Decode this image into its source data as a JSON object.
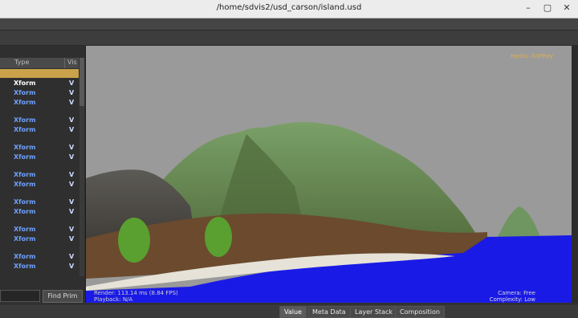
{
  "window": {
    "title": "/home/sdvis2/usd_carson/island.usd",
    "controls": [
      "–",
      "▢",
      "✕"
    ]
  },
  "prim_tree": {
    "col_type": "Type",
    "col_vis": "Vis",
    "rows": [
      {
        "type": "Xform",
        "vis": "V",
        "style": "white"
      },
      {
        "type": "Xform",
        "vis": "V",
        "style": "blue"
      },
      {
        "type": "Xform",
        "vis": "V",
        "style": "blue"
      },
      {
        "type": "Xform",
        "vis": "V",
        "style": "blue"
      },
      {
        "type": "Xform",
        "vis": "V",
        "style": "blue"
      },
      {
        "type": "Xform",
        "vis": "V",
        "style": "blue"
      },
      {
        "type": "Xform",
        "vis": "V",
        "style": "blue"
      },
      {
        "type": "Xform",
        "vis": "V",
        "style": "blue"
      },
      {
        "type": "Xform",
        "vis": "V",
        "style": "blue"
      },
      {
        "type": "Xform",
        "vis": "V",
        "style": "blue"
      },
      {
        "type": "Xform",
        "vis": "V",
        "style": "blue"
      },
      {
        "type": "Xform",
        "vis": "V",
        "style": "blue"
      },
      {
        "type": "Xform",
        "vis": "V",
        "style": "blue"
      },
      {
        "type": "Xform",
        "vis": "V",
        "style": "blue"
      },
      {
        "type": "Xform",
        "vis": "V",
        "style": "blue"
      }
    ],
    "find_button": "Find Prim"
  },
  "viewport": {
    "hydra": "Hydra: GSPRay",
    "render": "Render: 113.14 ms (8.84 FPS)",
    "playback": "Playback: N/A",
    "camera": "Camera: Free",
    "complexity": "Complexity: Low"
  },
  "tabs": [
    "Value",
    "Meta Data",
    "Layer Stack",
    "Composition"
  ],
  "active_tab": "Value",
  "colors": {
    "selection": "#c9a24a",
    "ocean": "#1a1ae6",
    "sky": "#9a9a9a",
    "hydra_label": "#e0b050"
  }
}
